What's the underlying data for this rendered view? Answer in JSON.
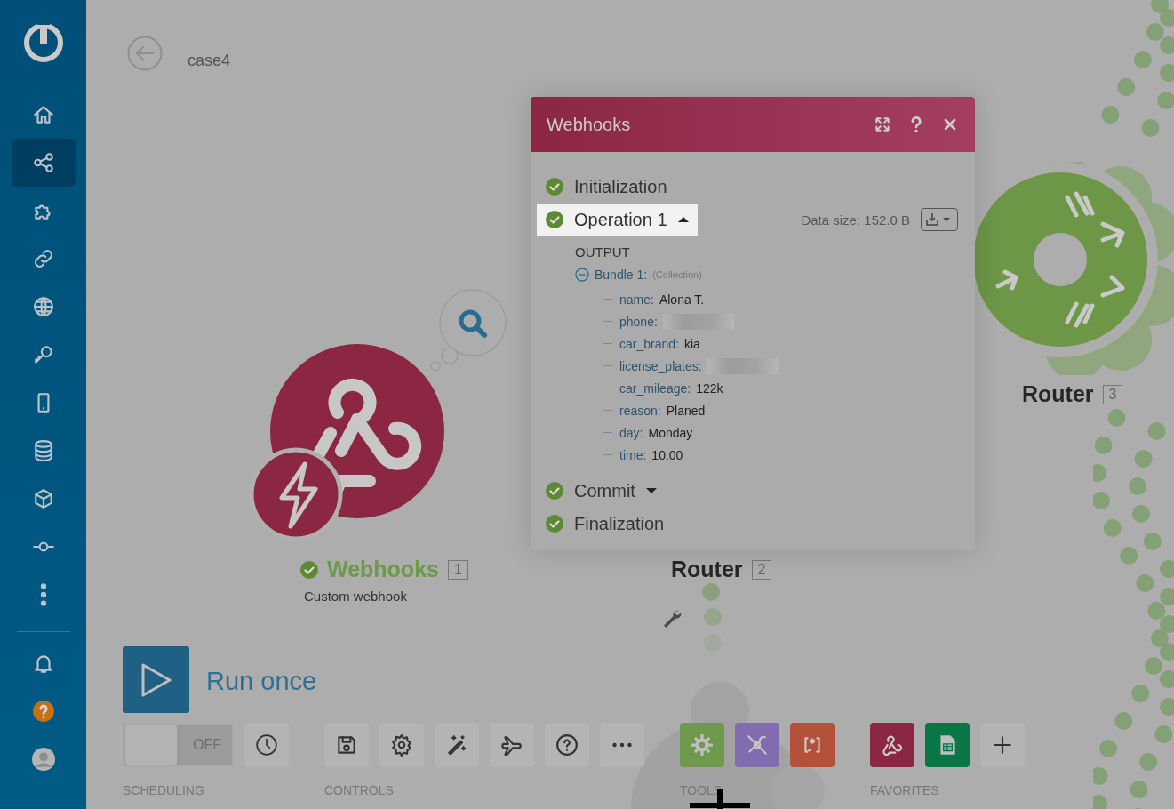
{
  "sidebar": {
    "items": [
      {
        "kind": "home",
        "selected": false
      },
      {
        "kind": "share",
        "selected": true
      },
      {
        "kind": "puzzle",
        "selected": false
      },
      {
        "kind": "link",
        "selected": false
      },
      {
        "kind": "globe",
        "selected": false
      },
      {
        "kind": "key",
        "selected": false
      },
      {
        "kind": "phone",
        "selected": false
      },
      {
        "kind": "database",
        "selected": false
      },
      {
        "kind": "cube",
        "selected": false
      },
      {
        "kind": "commit",
        "selected": false
      },
      {
        "kind": "dots",
        "selected": false
      }
    ],
    "bottom_items": [
      {
        "kind": "bell"
      },
      {
        "kind": "help"
      },
      {
        "kind": "avatar"
      }
    ]
  },
  "header": {
    "title": "case4"
  },
  "nodes": [
    {
      "kind": "webhook",
      "title": "Webhooks",
      "number": "1",
      "subtitle": "Custom webhook",
      "success": true
    },
    {
      "kind": "router",
      "title": "Router",
      "number": "2",
      "success": false
    },
    {
      "kind": "router",
      "title": "Router",
      "number": "3",
      "success": false
    }
  ],
  "popup": {
    "title": "Webhooks",
    "data_size": "Data size: 152.0 B",
    "output_label": "OUTPUT",
    "steps": [
      {
        "label": "Initialization",
        "selected": false
      },
      {
        "label": "Operation 1",
        "selected": true,
        "expanded": true
      },
      {
        "label": "Commit",
        "selected": false,
        "expanded": false
      },
      {
        "label": "Finalization",
        "selected": false
      }
    ],
    "bundle": {
      "label": "Bundle 1:",
      "type": "(Collection)",
      "expanded": true,
      "fields": [
        {
          "key": "name:",
          "value": "Alona T.",
          "redacted": false
        },
        {
          "key": "phone:",
          "redacted": true
        },
        {
          "key": "car_brand:",
          "value": "kia",
          "redacted": false
        },
        {
          "key": "license_plates:",
          "redacted": true
        },
        {
          "key": "car_mileage:",
          "value": "122k",
          "redacted": false
        },
        {
          "key": "reason:",
          "value": "Planed",
          "redacted": false
        },
        {
          "key": "day:",
          "value": "Monday",
          "redacted": false
        },
        {
          "key": "time:",
          "value": "10.00",
          "redacted": false
        }
      ]
    }
  },
  "run_once": {
    "label": "Run once"
  },
  "toolbar": {
    "scheduling": {
      "label": "SCHEDULING",
      "switch_text": "OFF",
      "on": false
    },
    "groups": [
      {
        "label": "CONTROLS",
        "buttons": [
          {
            "kind": "save"
          },
          {
            "kind": "gear"
          },
          {
            "kind": "wand"
          },
          {
            "kind": "plane"
          },
          {
            "kind": "question"
          },
          {
            "kind": "more"
          }
        ]
      },
      {
        "label": "TOOLS",
        "buttons": [
          {
            "kind": "tools-gear"
          },
          {
            "kind": "tools-flow"
          },
          {
            "kind": "tools-text"
          }
        ]
      },
      {
        "label": "FAVORITES",
        "buttons": [
          {
            "kind": "fav-webhook"
          },
          {
            "kind": "fav-sheets"
          },
          {
            "kind": "add"
          }
        ]
      }
    ]
  }
}
